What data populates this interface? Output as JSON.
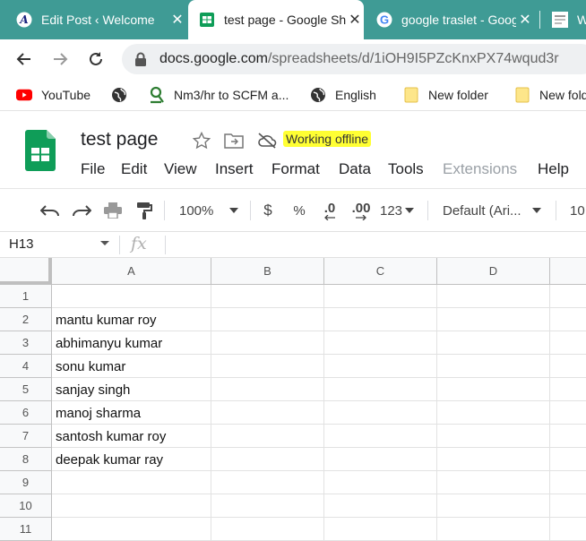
{
  "browser": {
    "tabs": [
      {
        "title": "Edit Post ‹ Welcome",
        "icon": "site-logo-icon",
        "active": false
      },
      {
        "title": "test page - Google Sheets",
        "icon": "sheets-icon",
        "active": true
      },
      {
        "title": "google traslet - Google Search",
        "icon": "google-icon",
        "active": false
      },
      {
        "title": "W",
        "icon": "site-favicon-icon",
        "active": false
      }
    ],
    "close_glyph": "✕",
    "url_domain": "docs.google.com",
    "url_path": "/spreadsheets/d/1iOH9I5PZcKnxPX74wqud3r",
    "bookmarks": [
      {
        "label": "YouTube",
        "icon": "youtube-icon"
      },
      {
        "label": "",
        "icon": "globe-icon"
      },
      {
        "label": "Nm3/hr to SCFM a...",
        "icon": "bookmark-site-icon"
      },
      {
        "label": "English",
        "icon": "globe-icon"
      },
      {
        "label": "New folder",
        "icon": "folder-icon"
      },
      {
        "label": "New fold",
        "icon": "folder-icon"
      }
    ]
  },
  "doc": {
    "title": "test page",
    "status": "Working offline",
    "menus": [
      "File",
      "Edit",
      "View",
      "Insert",
      "Format",
      "Data",
      "Tools",
      "Extensions",
      "Help"
    ]
  },
  "toolbar": {
    "zoom": "100%",
    "currency": "$",
    "percent": "%",
    "dec_decrease": ".0",
    "dec_increase": ".00",
    "number_format": "123",
    "font": "Default (Ari...",
    "font_size": "10"
  },
  "formula_bar": {
    "cell_ref": "H13",
    "fx": "fx",
    "content": ""
  },
  "sheet": {
    "columns": [
      "A",
      "B",
      "C",
      "D"
    ],
    "rows": [
      "1",
      "2",
      "3",
      "4",
      "5",
      "6",
      "7",
      "8",
      "9",
      "10",
      "11"
    ],
    "col_a_values": [
      "",
      "mantu kumar roy",
      "abhimanyu kumar",
      "sonu kumar",
      "sanjay singh",
      "manoj sharma",
      "santosh kumar roy",
      "deepak kumar ray",
      "",
      "",
      ""
    ]
  },
  "colors": {
    "tab_bar": "#3f9b95",
    "offline_highlight": "#ffff33",
    "sheets_green": "#0f9d58"
  }
}
